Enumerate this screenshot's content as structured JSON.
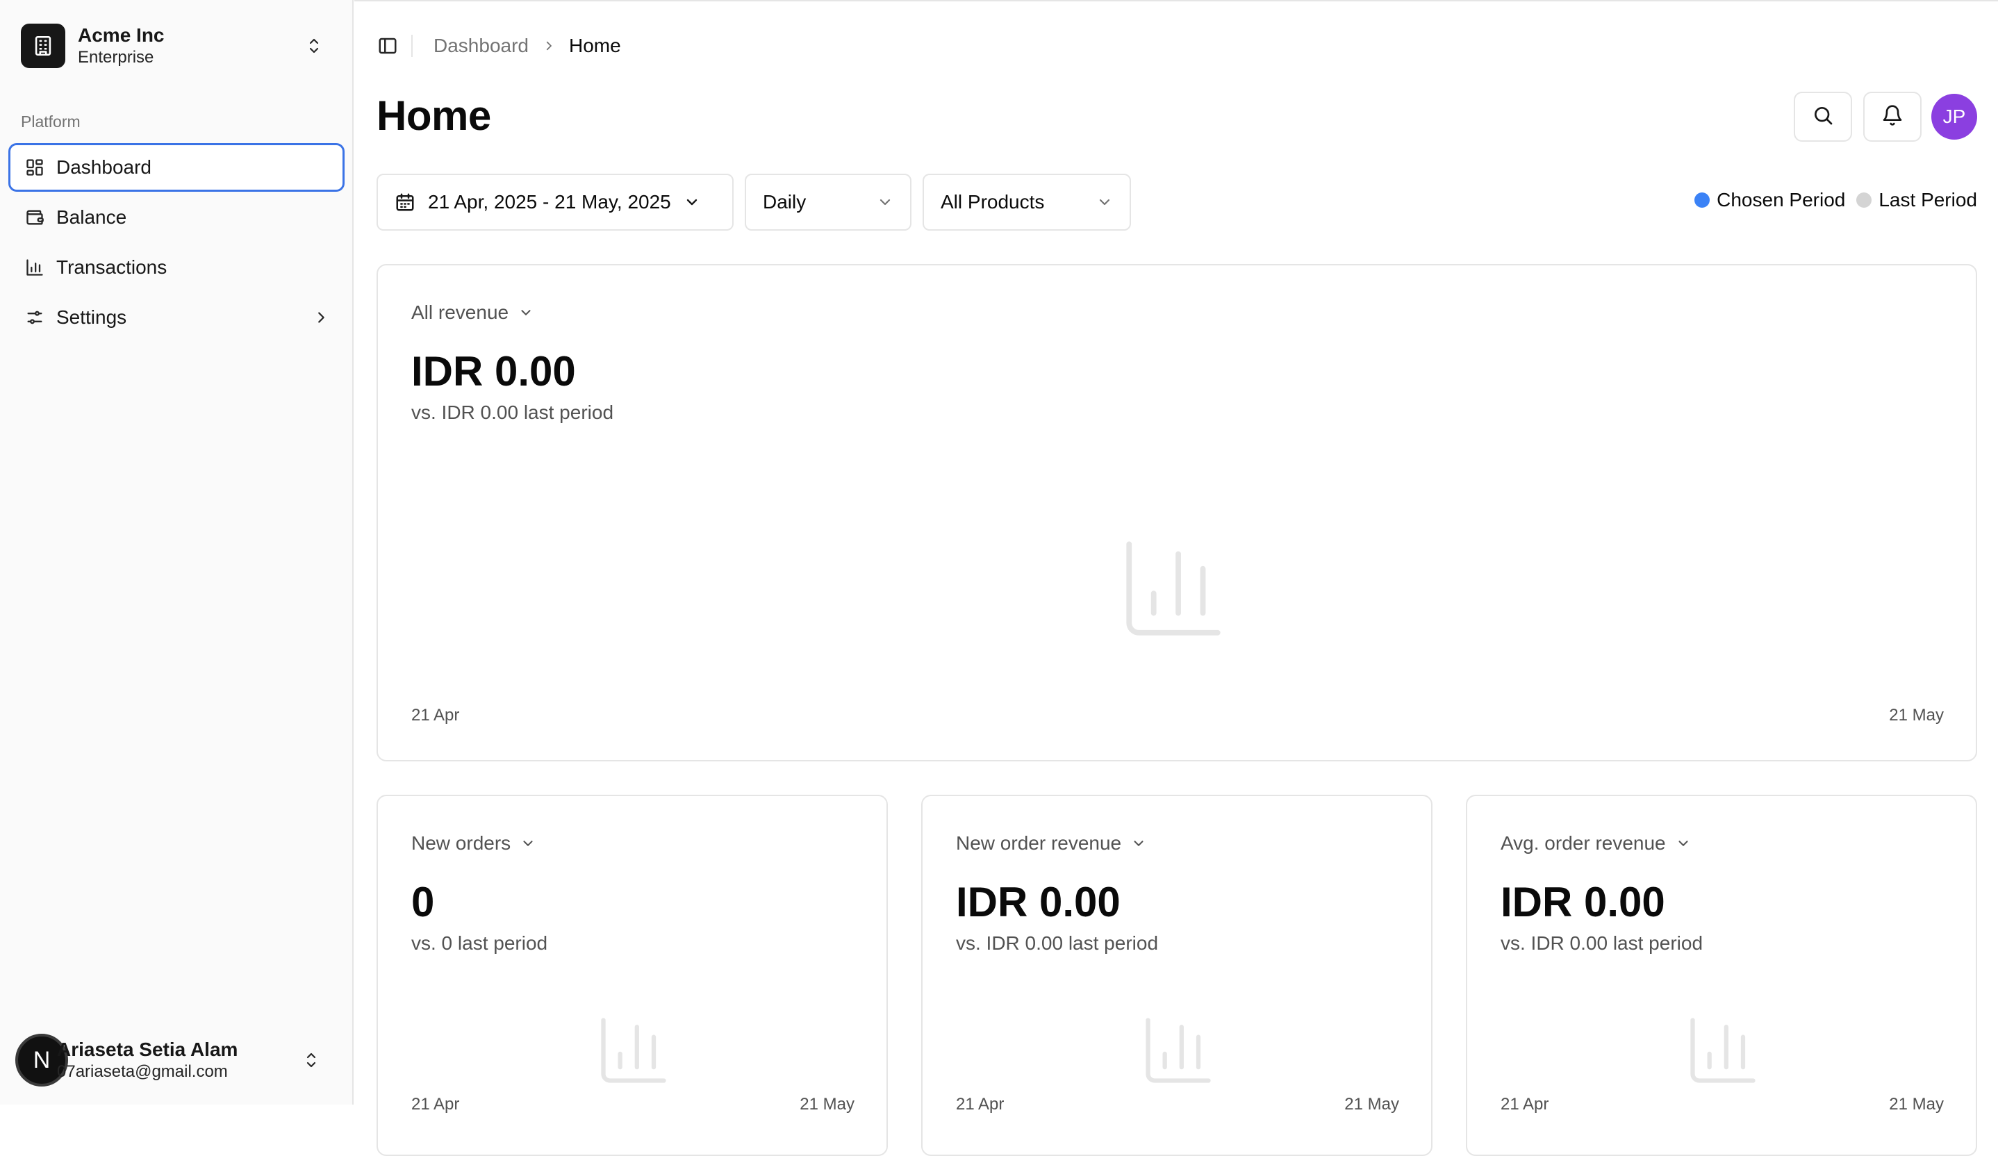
{
  "sidebar": {
    "team": {
      "name": "Acme Inc",
      "plan": "Enterprise"
    },
    "group_label": "Platform",
    "items": [
      {
        "label": "Dashboard",
        "icon": "layout-grid-icon",
        "active": true
      },
      {
        "label": "Balance",
        "icon": "wallet-icon"
      },
      {
        "label": "Transactions",
        "icon": "bar-chart-icon"
      },
      {
        "label": "Settings",
        "icon": "sliders-icon",
        "has_submenu": true
      }
    ],
    "user": {
      "initial": "N",
      "name": "Ariaseta Setia Alam",
      "email": "07ariaseta@gmail.com"
    }
  },
  "breadcrumb": {
    "parent": "Dashboard",
    "current": "Home"
  },
  "page_title": "Home",
  "header": {
    "avatar_initials": "JP",
    "avatar_color": "#8b3fe0"
  },
  "filters": {
    "date_range": "21 Apr, 2025 - 21 May, 2025",
    "period": "Daily",
    "product": "All Products"
  },
  "legend": {
    "chosen": {
      "label": "Chosen Period",
      "color": "#3b82f6"
    },
    "last": {
      "label": "Last Period",
      "color": "#d4d4d4"
    }
  },
  "cards": {
    "main": {
      "title": "All revenue",
      "value": "IDR 0.00",
      "compare": "vs. IDR 0.00 last period",
      "x_start": "21 Apr",
      "x_end": "21 May"
    },
    "new_orders": {
      "title": "New orders",
      "value": "0",
      "compare": "vs. 0 last period",
      "x_start": "21 Apr",
      "x_end": "21 May"
    },
    "new_order_revenue": {
      "title": "New order revenue",
      "value": "IDR 0.00",
      "compare": "vs. IDR 0.00 last period",
      "x_start": "21 Apr",
      "x_end": "21 May"
    },
    "avg_order_revenue": {
      "title": "Avg. order revenue",
      "value": "IDR 0.00",
      "compare": "vs. IDR 0.00 last period",
      "x_start": "21 Apr",
      "x_end": "21 May"
    }
  }
}
